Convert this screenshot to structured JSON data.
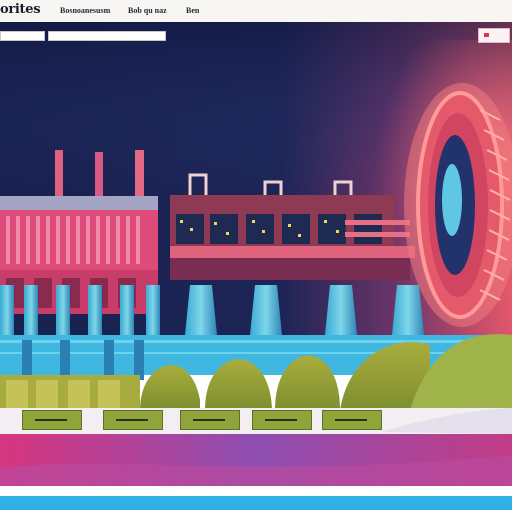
{
  "header": {
    "brand": "orites",
    "nav": [
      "Bosnoanesusm",
      "Bob qu naz",
      "Ben"
    ]
  },
  "colors": {
    "night_sky": "#17214f",
    "sunset_glow": "#e0516a",
    "hill_green": "#a2a83c",
    "river_blue": "#3fb7e0",
    "pink_band": "#d83a84"
  },
  "icons": [
    "turbine-wheel-icon",
    "factory-chimney-icon"
  ]
}
